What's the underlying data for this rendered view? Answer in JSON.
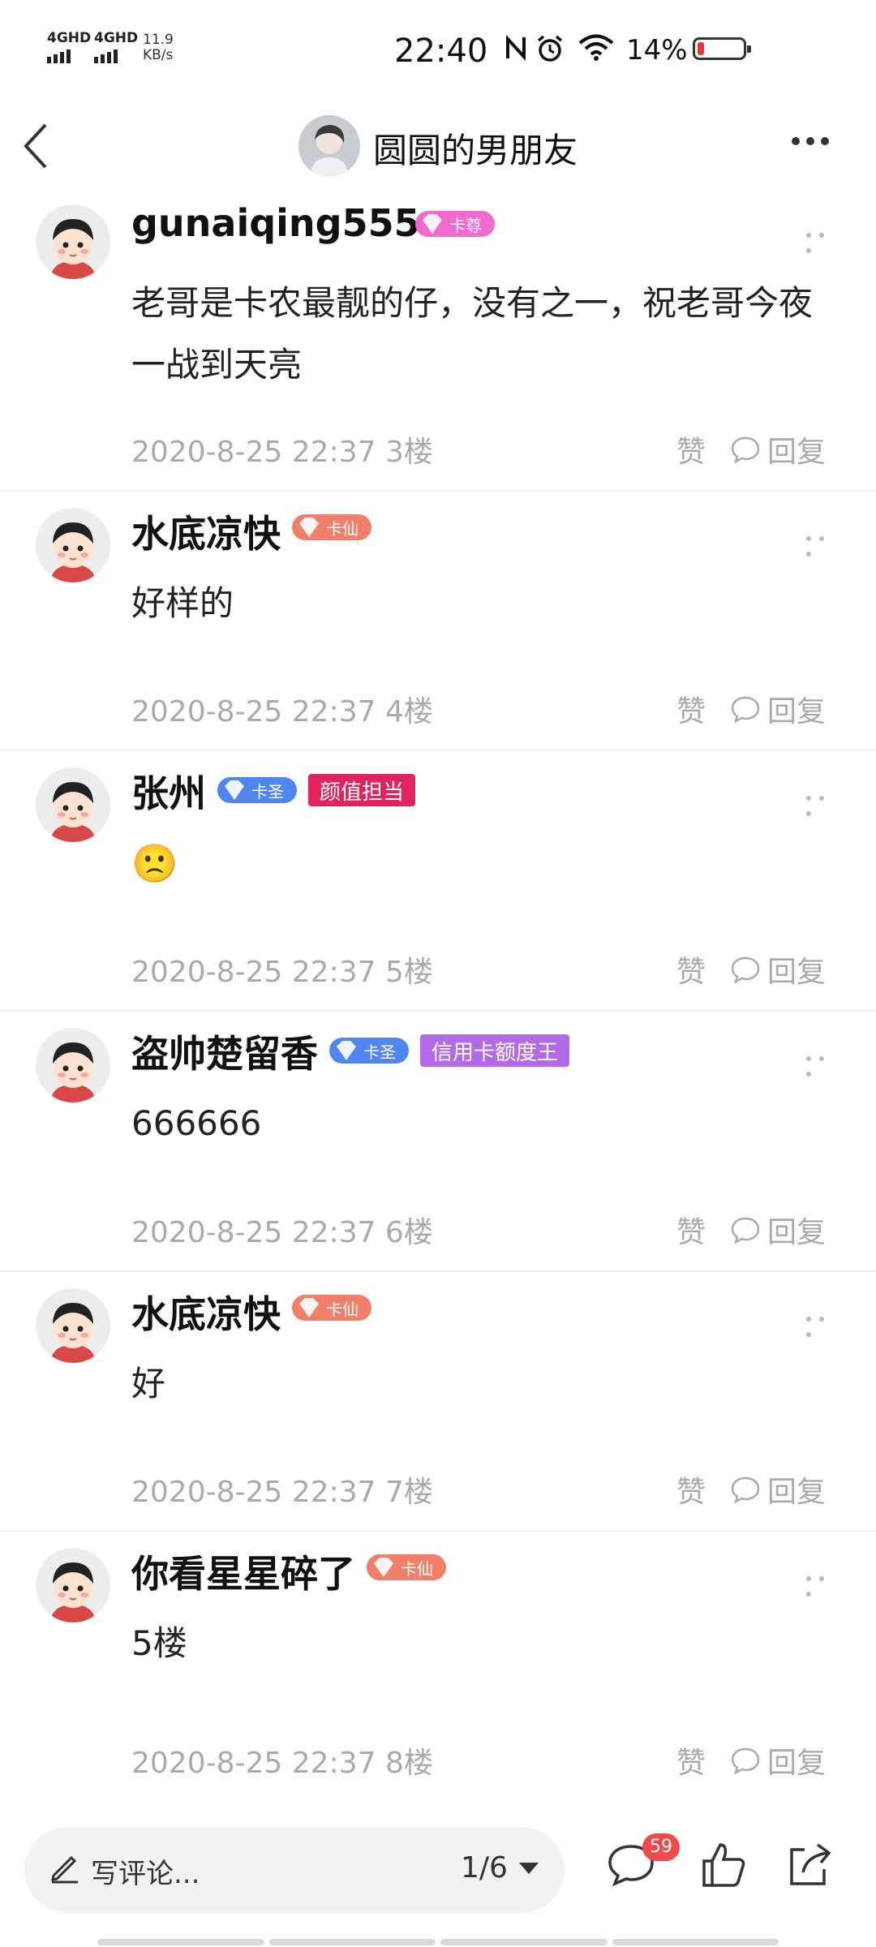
{
  "status": {
    "sim1": "4GHD",
    "sim2": "4GHD",
    "speed_value": "11.9",
    "speed_unit": "KB/s",
    "time": "22:40",
    "battery": "14%"
  },
  "header": {
    "title": "圆圆的男朋友"
  },
  "comments": [
    {
      "name": "gunaiqing555",
      "level": "卡尊",
      "tag": "",
      "text": "老哥是卡农最靓的仔，没有之一，祝老哥今夜一战到天亮",
      "date": "2020-8-25 22:37",
      "floor": "3楼",
      "like": "赞",
      "reply": "回复"
    },
    {
      "name": "水底凉快",
      "level": "卡仙",
      "tag": "",
      "text": "好样的",
      "date": "2020-8-25 22:37",
      "floor": "4楼",
      "like": "赞",
      "reply": "回复"
    },
    {
      "name": "张州",
      "level": "卡圣",
      "tag": "颜值担当",
      "text": "🙁",
      "date": "2020-8-25 22:37",
      "floor": "5楼",
      "like": "赞",
      "reply": "回复"
    },
    {
      "name": "盗帅楚留香",
      "level": "卡圣",
      "tag": "信用卡额度王",
      "text": "666666",
      "date": "2020-8-25 22:37",
      "floor": "6楼",
      "like": "赞",
      "reply": "回复"
    },
    {
      "name": "水底凉快",
      "level": "卡仙",
      "tag": "",
      "text": "好",
      "date": "2020-8-25 22:37",
      "floor": "7楼",
      "like": "赞",
      "reply": "回复"
    },
    {
      "name": "你看星星碎了",
      "level": "卡仙",
      "tag": "",
      "text": "5楼",
      "date": "2020-8-25 22:37",
      "floor": "8楼",
      "like": "赞",
      "reply": "回复"
    }
  ],
  "bottom": {
    "placeholder": "写评论...",
    "page": "1/6",
    "comment_count": "59"
  },
  "colors": {
    "zun": "#f06ad0",
    "xian": "#f0806a",
    "sheng": "#4f86f0",
    "tag_red": "#e0245e",
    "tag_purple": "#b36ae6",
    "badge": "#f04a4a"
  }
}
